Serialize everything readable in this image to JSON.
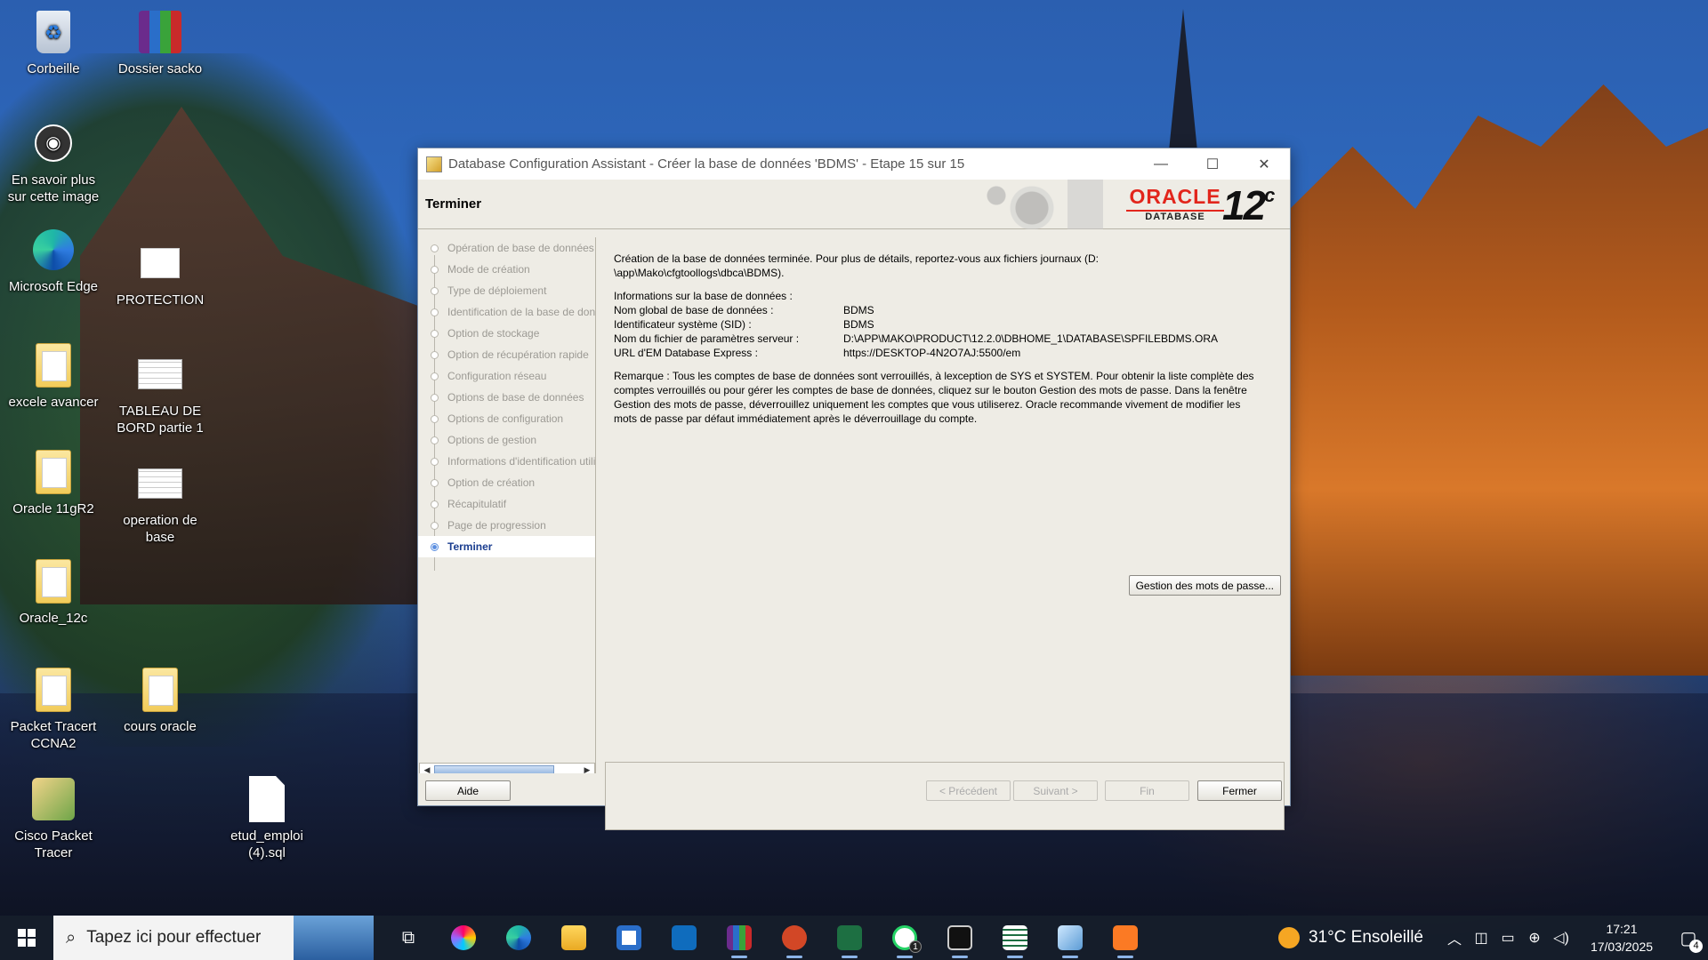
{
  "desktop": {
    "icons": [
      {
        "label": "Corbeille"
      },
      {
        "label": "Dossier sacko"
      },
      {
        "label": "En savoir plus sur cette image"
      },
      {
        "label": "Microsoft Edge"
      },
      {
        "label": "PROTECTION"
      },
      {
        "label": "excele avancer"
      },
      {
        "label": "TABLEAU DE BORD partie 1"
      },
      {
        "label": "Oracle 11gR2"
      },
      {
        "label": "operation de base"
      },
      {
        "label": "Oracle_12c"
      },
      {
        "label": "Packet Tracert CCNA2"
      },
      {
        "label": "cours oracle"
      },
      {
        "label": "Cisco Packet Tracer"
      },
      {
        "label": "etud_emploi (4).sql"
      }
    ]
  },
  "dialog": {
    "title": "Database Configuration Assistant - Créer la base de données 'BDMS' - Etape 15 sur 15",
    "window_controls": {
      "minimize": "—",
      "maximize": "☐",
      "close": "✕"
    },
    "header_title": "Terminer",
    "logo": {
      "brand": "ORACLE",
      "sub": "DATABASE",
      "version": "12",
      "version_sup": "c"
    },
    "steps": [
      {
        "label": "Opération de base de données"
      },
      {
        "label": "Mode de création"
      },
      {
        "label": "Type de déploiement"
      },
      {
        "label": "Identification de la base de données"
      },
      {
        "label": "Option de stockage"
      },
      {
        "label": "Option de récupération rapide"
      },
      {
        "label": "Configuration réseau"
      },
      {
        "label": "Options de base de données"
      },
      {
        "label": "Options de configuration"
      },
      {
        "label": "Options de gestion"
      },
      {
        "label": "Informations d'identification utilisateur"
      },
      {
        "label": "Option de création"
      },
      {
        "label": "Récapitulatif"
      },
      {
        "label": "Page de progression"
      },
      {
        "label": "Terminer"
      }
    ],
    "active_step": "Terminer",
    "content": {
      "intro_line1": "Création de la base de données terminée. Pour plus de détails, reportez-vous aux fichiers journaux (D:",
      "intro_line2": "\\app\\Mako\\cfgtoollogs\\dbca\\BDMS).",
      "info_heading": "Informations sur la base de données :",
      "info": [
        {
          "key": "Nom global de base de données :",
          "value": "BDMS"
        },
        {
          "key": "Identificateur système (SID) :",
          "value": "BDMS"
        },
        {
          "key": "Nom du fichier de paramètres serveur :",
          "value": "D:\\APP\\MAKO\\PRODUCT\\12.2.0\\DBHOME_1\\DATABASE\\SPFILEBDMS.ORA"
        },
        {
          "key": "URL d'EM Database Express :",
          "value": "https://DESKTOP-4N2O7AJ:5500/em"
        }
      ],
      "remark_line1": "Remarque : Tous les comptes de base de données sont verrouillés, à lexception de SYS et SYSTEM. Pour obtenir la liste complète des",
      "remark_line2": "comptes verrouillés ou pour gérer les comptes de base de données, cliquez sur le bouton Gestion des mots de passe. Dans la fenêtre",
      "remark_line3": "Gestion des mots de passe, déverrouillez uniquement les comptes que vous utiliserez. Oracle recommande vivement de modifier les",
      "remark_line4": "mots de passe par défaut immédiatement après le déverrouillage du compte.",
      "password_button": "Gestion des mots de passe..."
    },
    "footer": {
      "help": "Aide",
      "previous": "< Précédent",
      "next": "Suivant >",
      "finish": "Fin",
      "close": "Fermer"
    }
  },
  "taskbar": {
    "search_placeholder": "Tapez ici pour effectuer",
    "whatsapp_badge": "1",
    "weather": "31°C  Ensoleillé",
    "time": "17:21",
    "date": "17/03/2025",
    "notifications": "4"
  }
}
